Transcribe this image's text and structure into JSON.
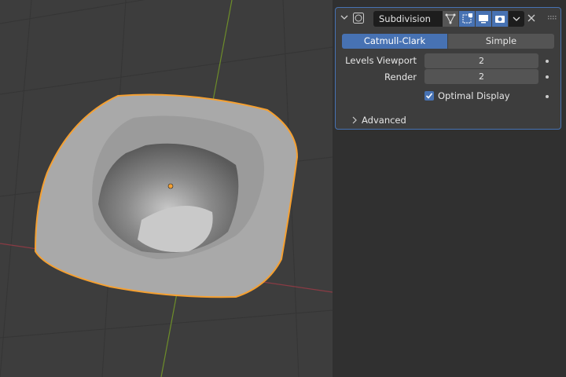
{
  "modifier": {
    "name": "Subdivision",
    "modes": [
      "Catmull-Clark",
      "Simple"
    ],
    "active_mode": "Catmull-Clark",
    "levels_viewport_label": "Levels Viewport",
    "levels_viewport": "2",
    "render_label": "Render",
    "render": "2",
    "optimal_display_label": "Optimal Display",
    "optimal_display": true,
    "advanced_label": "Advanced"
  },
  "colors": {
    "accent": "#4772b3",
    "selection": "#f5a031"
  }
}
